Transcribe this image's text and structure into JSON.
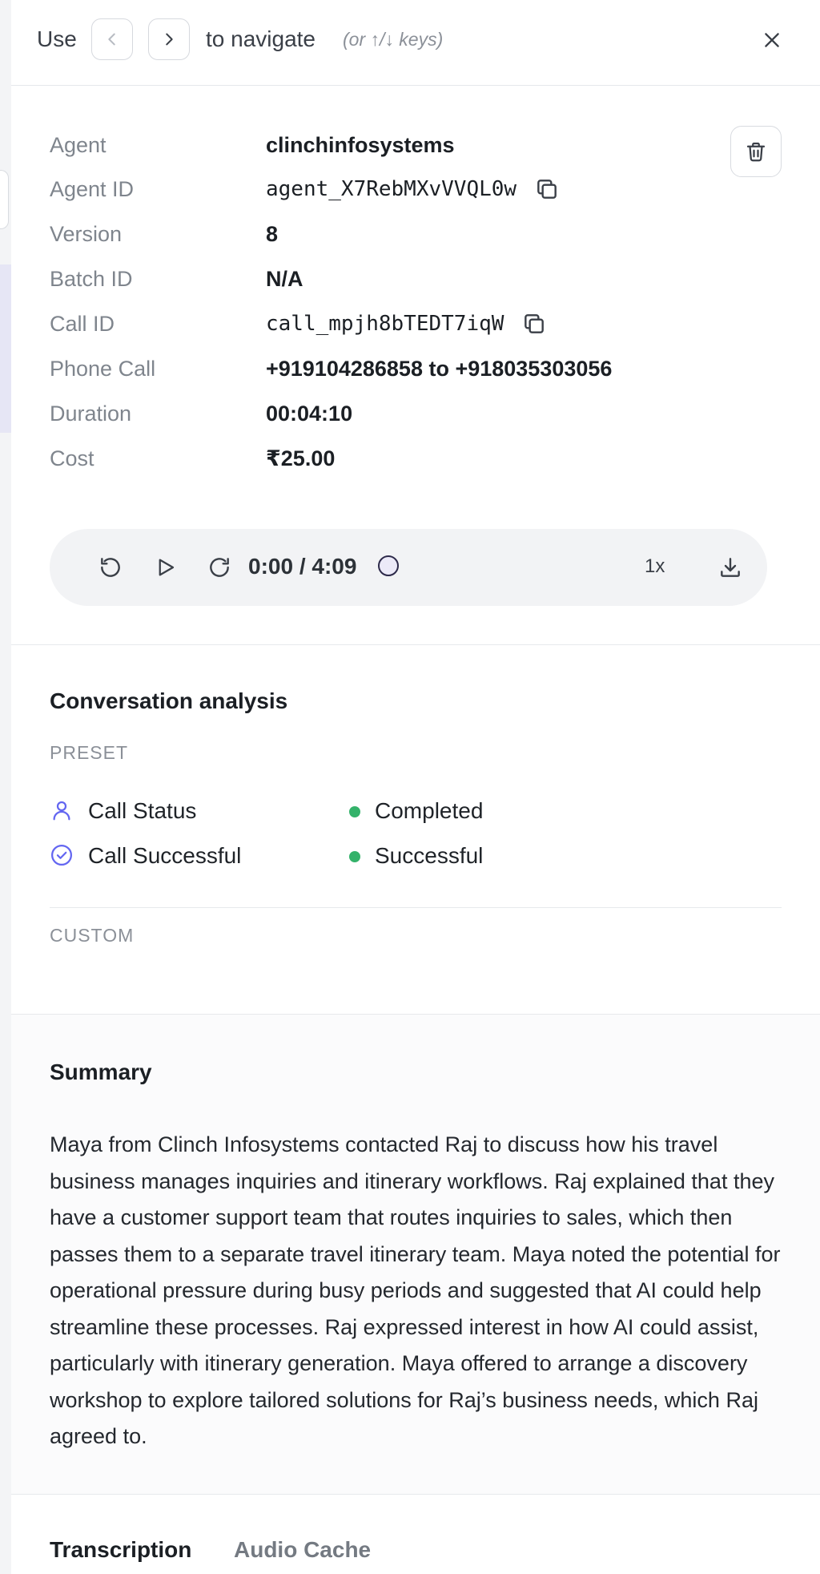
{
  "nav": {
    "use_label": "Use",
    "to_navigate_label": "to navigate",
    "keys_hint": "(or ↑/↓ keys)"
  },
  "details": {
    "agent": {
      "label": "Agent",
      "value": "clinchinfosystems"
    },
    "agent_id": {
      "label": "Agent ID",
      "value": "agent_X7RebMXvVVQL0w"
    },
    "version": {
      "label": "Version",
      "value": "8"
    },
    "batch_id": {
      "label": "Batch ID",
      "value": "N/A"
    },
    "call_id": {
      "label": "Call ID",
      "value": "call_mpjh8bTEDT7iqW"
    },
    "phone_call": {
      "label": "Phone Call",
      "value": "+919104286858 to +918035303056"
    },
    "duration": {
      "label": "Duration",
      "value": "00:04:10"
    },
    "cost": {
      "label": "Cost",
      "value": "₹25.00"
    }
  },
  "player": {
    "time": "0:00 / 4:09",
    "speed": "1x",
    "progress": 0
  },
  "analysis": {
    "title": "Conversation analysis",
    "preset_label": "PRESET",
    "custom_label": "CUSTOM",
    "rows": [
      {
        "name": "Call Status",
        "status": "Completed",
        "icon": "user-icon",
        "status_color": "#34b26a"
      },
      {
        "name": "Call Successful",
        "status": "Successful",
        "icon": "check-circle-icon",
        "status_color": "#34b26a"
      }
    ]
  },
  "summary": {
    "title": "Summary",
    "text": "Maya from Clinch Infosystems contacted Raj to discuss how his travel business manages inquiries and itinerary workflows. Raj explained that they have a customer support team that routes inquiries to sales, which then passes them to a separate travel itinerary team. Maya noted the potential for operational pressure during busy periods and suggested that AI could help streamline these processes. Raj expressed interest in how AI could assist, particularly with itinerary generation. Maya offered to arrange a discovery workshop to explore tailored solutions for Raj’s business needs, which Raj agreed to."
  },
  "tabs": [
    {
      "label": "Transcription",
      "active": true
    },
    {
      "label": "Audio Cache",
      "active": false
    }
  ],
  "colors": {
    "accent": "#6366f1",
    "status_green": "#34b26a"
  }
}
